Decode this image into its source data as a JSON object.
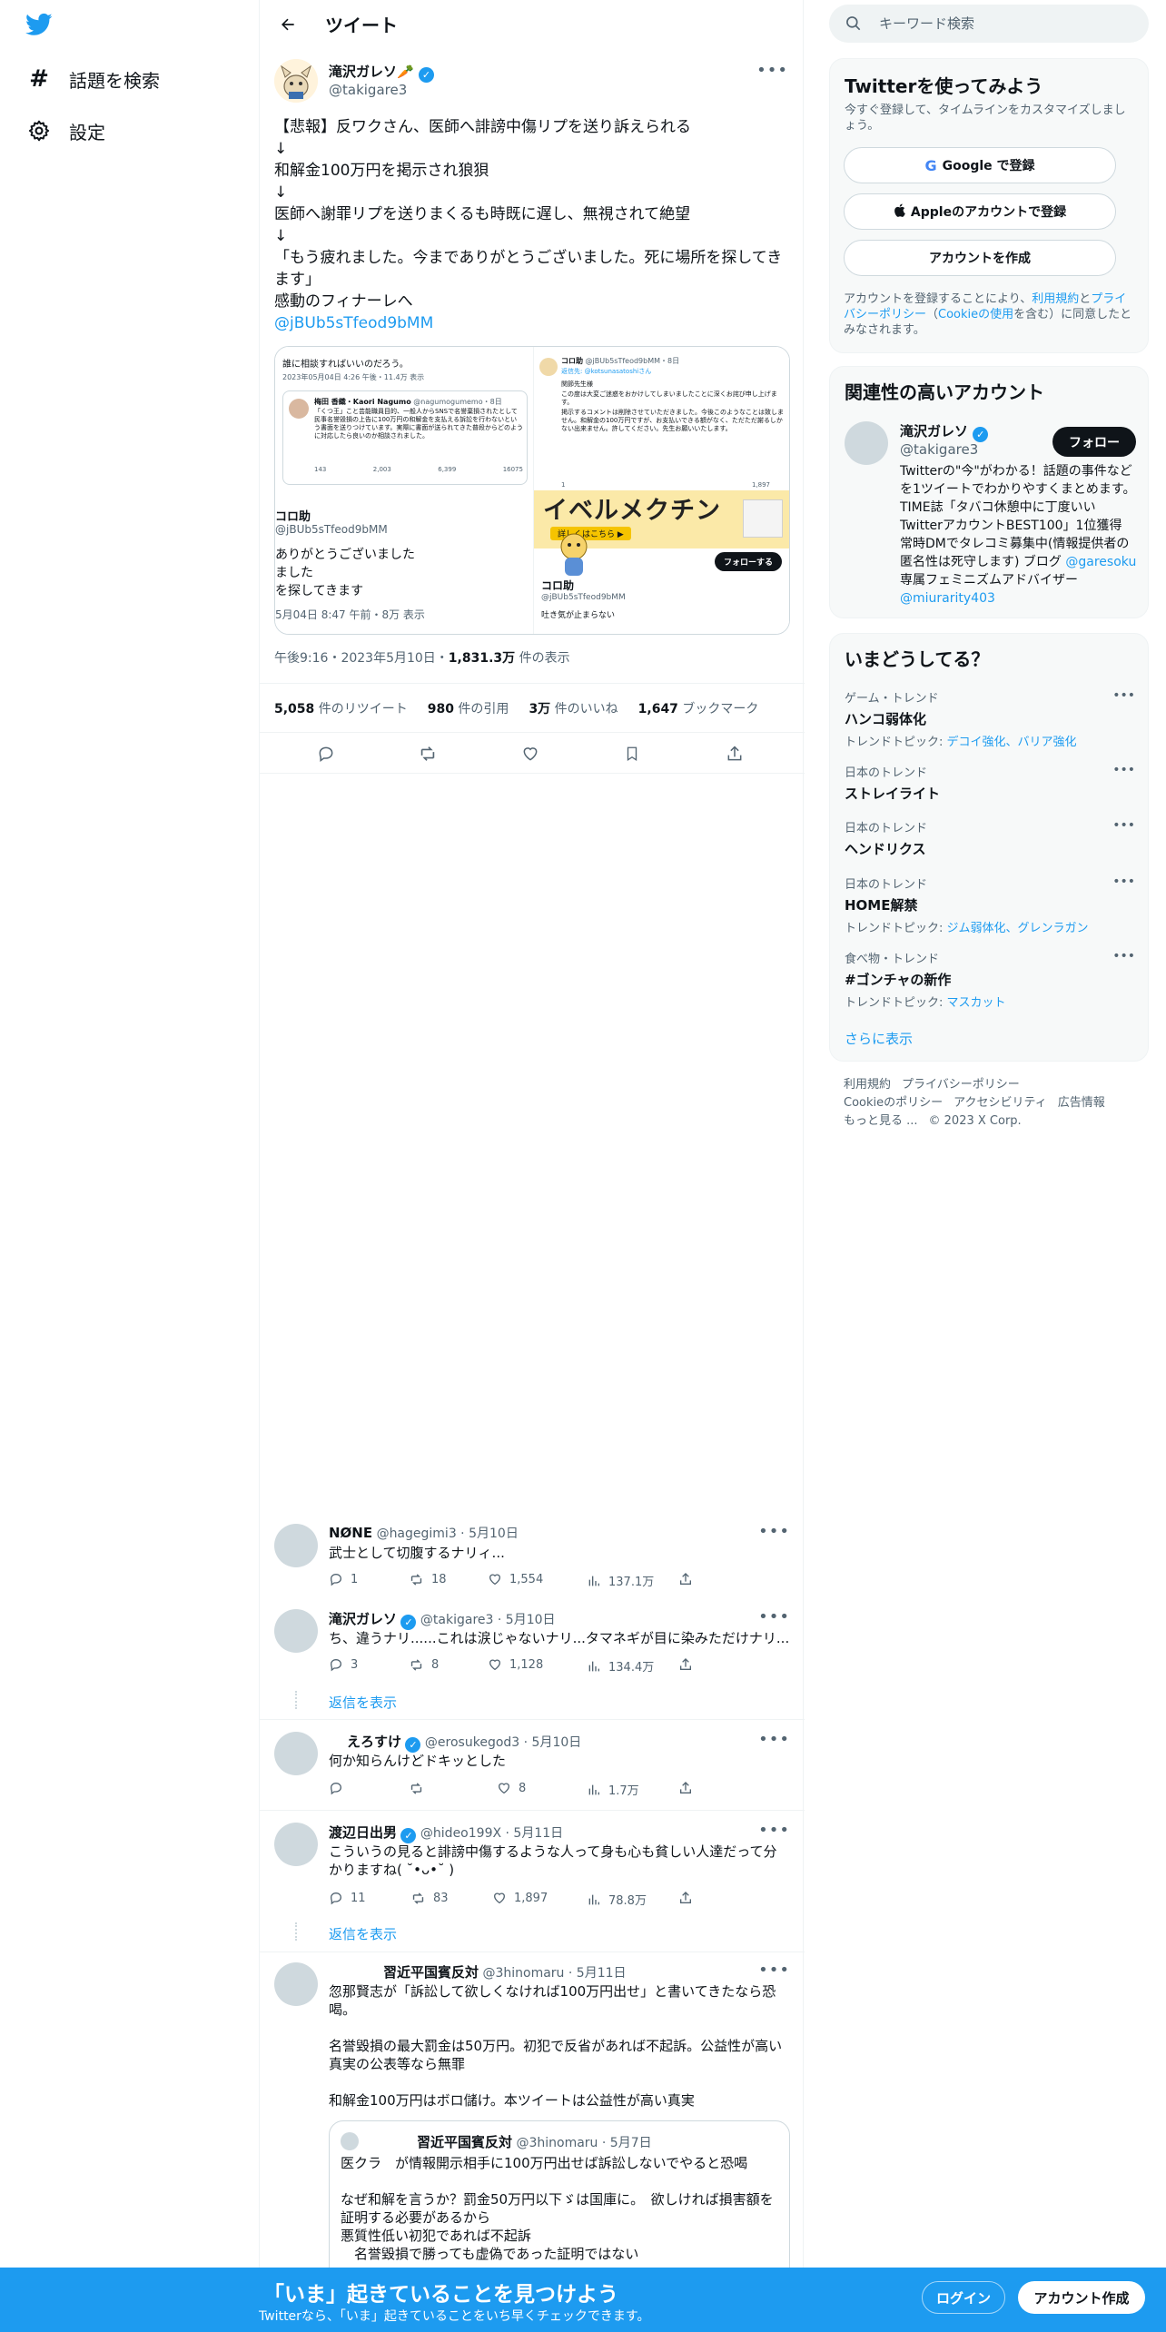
{
  "colors": {
    "accent": "#1d9bf0",
    "text": "#0f1419",
    "secondary": "#536471",
    "border": "#eff3f4"
  },
  "nav": {
    "explore_label": "話題を検索",
    "settings_label": "設定"
  },
  "header": {
    "title": "ツイート"
  },
  "tweet": {
    "author_name": "滝沢ガレソ🥕",
    "author_handle": "@takigare3",
    "lines": [
      "【悲報】反ワクさん、医師へ誹謗中傷リプを送り訴えられる",
      "↓",
      "和解金100万円を掲示され狼狽",
      "↓",
      "医師へ謝罪リプを送りまくるも時既に遅し、無視されて絶望",
      "↓",
      "「もう疲れました。今までありがとうございました。死に場所を探してき",
      "ます」",
      "感動のフィナーレへ"
    ],
    "link": "@jBUb5sTfeod9bMM",
    "time": "午後9:16・2023年5月10日・",
    "views_value": "1,831.3万",
    "views_label": " 件の表示",
    "stats": {
      "retweets_value": "5,058",
      "retweets_label": " 件のリツイート",
      "quotes_value": "980",
      "quotes_label": " 件の引用",
      "likes_value": "3万",
      "likes_label": " 件のいいね",
      "bookmarks_value": "1,647",
      "bookmarks_label": " ブックマーク"
    },
    "media": {
      "left_top_text": "誰に相談すればいいのだろう。",
      "left_top_meta": "2023年05月04日 4:26 午後・11.4万 表示",
      "inner_name": "梅田 香織・Kaori Nagumo",
      "inner_handle": "@nagumogumemo・8日",
      "inner_text": "「くつ王」こと芸能職員目的、一般人からSNSで名誉棄損されたとして民事名誉毀損の上告に100万円の和解金を支払える訴訟を行わないという書面を送りつけています。実際に書面が送られてきた普段からどのように対応したら良いのか相談されました。",
      "inner_counts": [
        "143",
        "2,003",
        "6,399",
        "16075"
      ],
      "left_name": "コロ助",
      "left_handle": "@jBUb5sTfeod9bMM",
      "left_lines": [
        "ありがとうございました",
        "ました",
        "を探してきます"
      ],
      "left_meta": "5月04日 8:47 午前・8万 表示",
      "right_name": "コロ助",
      "right_handle": "@jBUb5sTfeod9bMM・8日",
      "right_reply": "返信先: @kotsunasatoshiさん",
      "right_text1": "関節先生様",
      "right_text2": "この度は大変ご迷惑をおかけしてしまいましたことに深くお詫び申し上げます。",
      "right_text3": "掲示するコメントは削除させていただきました。今後このようなことは致しません。和解金の100万円ですが、お支払いできる額がなく、ただただ謝るしかない出来ません。許してください。先生お願いいたします。",
      "right_counts": [
        "1",
        "",
        "1,897"
      ],
      "banner_text": "イベルメクチン",
      "banner_button": "詳しくはこちら ▶",
      "follow_button": "フォローする",
      "bottom_name": "コロ助",
      "bottom_handle": "@jBUb5sTfeod9bMM",
      "bottom_text": "吐き気が止まらない"
    }
  },
  "replies": [
    {
      "name": "NØNE",
      "handle": "@hagegimi3",
      "date": "5月10日",
      "text": "武士として切腹するナリィ...",
      "reply": "1",
      "retweet": "18",
      "like": "1,554",
      "views": "137.1万"
    },
    {
      "name": "滝沢ガレソ",
      "handle": "@takigare3",
      "date": "5月10日",
      "text": "ち、違うナリ......これは涙じゃないナリ...タマネギが目に染みただけナリ...",
      "reply": "3",
      "retweet": "8",
      "like": "1,128",
      "views": "134.4万",
      "show_replies": "返信を表示"
    },
    {
      "name": "えろすけ",
      "handle": "@erosukegod3",
      "date": "5月10日",
      "text": "何か知らんけどドキッとした",
      "reply": "",
      "retweet": "",
      "like": "8",
      "views": "1.7万"
    },
    {
      "name": "渡辺日出男",
      "handle": "@hideo199X",
      "date": "5月11日",
      "text": "こういうの見ると誹謗中傷するような人って身も心も貧しい人達だって分かりますね( ˘•ᴗ•˘ )",
      "reply": "11",
      "retweet": "83",
      "like": "1,897",
      "views": "78.8万",
      "show_replies": "返信を表示"
    },
    {
      "name": "習近平国賓反対",
      "handle": "@3hinomaru",
      "date": "5月11日",
      "lines": [
        "忽那賢志が「訴訟して欲しくなければ100万円出せ」と書いてきたなら恐",
        "喝。",
        "",
        "名誉毀損の最大罰金は50万円。初犯で反省があれば不起訴。公益性が高い",
        "真実の公表等なら無罪",
        "",
        "和解金100万円はボロ儲け。本ツイートは公益性が高い真実"
      ],
      "quote": {
        "name": "習近平国賓反対",
        "handle": "@3hinomaru",
        "date": "5月7日",
        "lines": [
          "医クラ　が情報開示相手に100万円出せば訴訟しないでやると恐喝",
          "",
          "なぜ和解を言うか？罰金50万円以下ゞは国庫に。　欲しければ損害額を",
          "証明する必要があるから",
          "悪質性低い初犯であれば不起訴",
          "　名誉毀損で勝っても虚偽であった証明ではない"
        ]
      }
    }
  ],
  "sidebar": {
    "search_placeholder": "キーワード検索",
    "signup": {
      "title": "Twitterを使ってみよう",
      "subtitle": "今すぐ登録して、タイムラインをカスタマイズしましょう。",
      "google_label": "Google で登録",
      "apple_label": "Appleのアカウントで登録",
      "create_label": "アカウントを作成",
      "terms_prefix": "アカウントを登録することにより、",
      "terms_link": "利用規約",
      "terms_mid": "と",
      "privacy_link": "プライバシーポリシー",
      "cookie_prefix": "（",
      "cookie_link": "Cookieの使用",
      "terms_suffix": "を含む）に同意したとみなされます。"
    },
    "related": {
      "title": "関連性の高いアカウント",
      "name": "滝沢ガレソ",
      "handle": "@takigare3",
      "follow_label": "フォロー",
      "bio": "Twitterの\"今\"がわかる！話題の事件などを1ツイートでわかりやすくまとめます。TIME誌「タバコ休憩中に丁度いいTwitterアカウントBEST100」1位獲得　常時DMでタレコミ募集中(情報提供者の匿名性は死守します) ブログ ",
      "bio_link1": "@garesoku",
      "bio_mid": " 専属フェミニズムアドバイザー ",
      "bio_link2": "@miurarity403"
    },
    "trends": {
      "title": "いまどうしてる？",
      "items": [
        {
          "category": "ゲーム・トレンド",
          "name": "ハンコ弱体化",
          "topic_label": "トレンドトピック: ",
          "topics": "デコイ強化、バリア強化"
        },
        {
          "category": "日本のトレンド",
          "name": "ストレイライト",
          "topic_label": "",
          "topics": ""
        },
        {
          "category": "日本のトレンド",
          "name": "ヘンドリクス",
          "topic_label": "",
          "topics": ""
        },
        {
          "category": "日本のトレンド",
          "name": "HOME解禁",
          "topic_label": "トレンドトピック: ",
          "topics": "ジム弱体化、グレンラガン"
        },
        {
          "category": "食べ物・トレンド",
          "name": "#ゴンチャの新作",
          "topic_label": "トレンドトピック: ",
          "topics": "マスカット"
        }
      ],
      "show_more": "さらに表示"
    },
    "footer": [
      "利用規約",
      "プライバシーポリシー",
      "Cookieのポリシー",
      "アクセシビリティ",
      "広告情報",
      "もっと見る ...",
      "© 2023 X Corp."
    ]
  },
  "bottombar": {
    "title": "「いま」起きていることを見つけよう",
    "subtitle": "Twitterなら、「いま」起きていることをいち早くチェックできます。",
    "login_label": "ログイン",
    "create_label": "アカウント作成"
  }
}
